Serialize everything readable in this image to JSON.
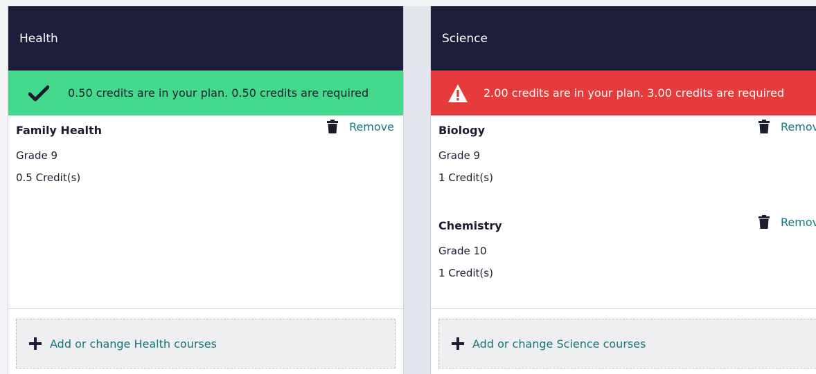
{
  "cards": [
    {
      "title": "Health",
      "status": {
        "type": "ok",
        "icon": "checkmark-icon",
        "text": "0.50 credits are in your plan. 0.50 credits are required"
      },
      "courses": [
        {
          "name": "Family Health",
          "grade": "Grade 9",
          "credits": "0.5 Credit(s)",
          "remove_label": "Remove"
        }
      ],
      "add_label": "Add or change Health courses"
    },
    {
      "title": "Science",
      "status": {
        "type": "error",
        "icon": "warning-icon",
        "text": "2.00 credits are in your plan. 3.00 credits are required"
      },
      "courses": [
        {
          "name": "Biology",
          "grade": "Grade 9",
          "credits": "1 Credit(s)",
          "remove_label": "Remove"
        },
        {
          "name": "Chemistry",
          "grade": "Grade 10",
          "credits": "1 Credit(s)",
          "remove_label": "Remove"
        }
      ],
      "add_label": "Add or change Science courses"
    }
  ],
  "colors": {
    "header_bg": "#1c1e3b",
    "ok_bg": "#44d98c",
    "error_bg": "#e53b3b",
    "accent": "#13777d"
  }
}
